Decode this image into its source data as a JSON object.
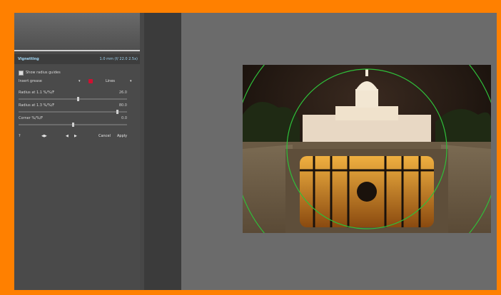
{
  "panel": {
    "title": "Vignetting",
    "header_value": "1.0 mm (f/ 22.0 2.5x)",
    "show_guide_label": "Show radius guides",
    "insert_label": "Insert grease",
    "mode_label": "Lines",
    "radius1_label": "Radius at 1.1 %/%/F",
    "radius1_value": "26.0",
    "radius1_level": 0.55,
    "radius2_label": "Radius at 1.3 %/%/F",
    "radius2_value": "80.0",
    "radius2_level": 0.92,
    "corner_label": "Corner %/%/F",
    "corner_value": "0.0",
    "corner_level": 0.5,
    "cancel_label": "Cancel",
    "apply_label": "Apply"
  },
  "colors": {
    "border": "#ff8000",
    "swatch": "#d01030",
    "guide": "#2fbf3a"
  },
  "icons": {
    "help": "?",
    "prev_next": "◀▶",
    "prev": "◀",
    "next": "▶"
  }
}
